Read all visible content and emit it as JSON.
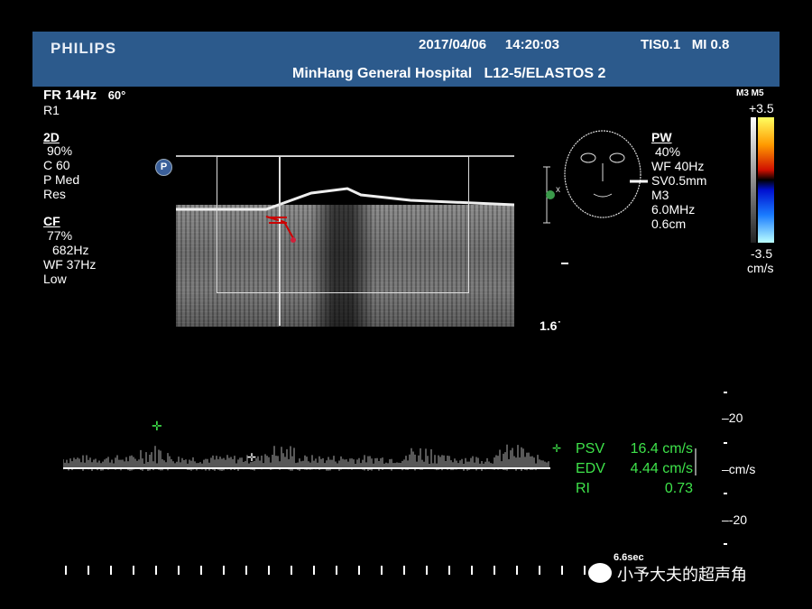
{
  "header": {
    "brand": "PHILIPS",
    "date": "2017/04/06",
    "time": "14:20:03",
    "tis": "TIS0.1",
    "mi": "MI 0.8",
    "hospital": "MinHang General Hospital",
    "probe": "L12-5/ELASTOS 2"
  },
  "left_params": {
    "frame_rate": "FR 14Hz",
    "angle": "60°",
    "r": "R1",
    "mode_2d": {
      "title": "2D",
      "gain": "90%",
      "compression": "C 60",
      "persistence": "P Med",
      "optimization": "Res"
    },
    "mode_cf": {
      "title": "CF",
      "gain": "77%",
      "prf": "682Hz",
      "wall_filter": "WF 37Hz",
      "setting": "Low"
    }
  },
  "pw_params": {
    "title": "PW",
    "gain": "40%",
    "wall_filter": "WF 40Hz",
    "sample_volume": "SV0.5mm",
    "preset": "M3",
    "frequency": "6.0MHz",
    "depth": "0.6cm"
  },
  "colorbar": {
    "label_top": "M3 M5",
    "max": "+3.5",
    "min": "-3.5",
    "unit": "cm/s"
  },
  "depth_label": "1.6",
  "spectrum": {
    "scale_top": "20",
    "scale_bottom": "-20",
    "unit": "cm/s",
    "sweep": "6.6sec"
  },
  "measurements": [
    {
      "label": "PSV",
      "value": "16.4 cm/s"
    },
    {
      "label": "EDV",
      "value": "4.44 cm/s"
    },
    {
      "label": "RI",
      "value": "0.73"
    }
  ],
  "watermark": "小予大夫的超声角",
  "colors": {
    "header_bg": "#2c5a8c",
    "measure_green": "#3ee24a",
    "roi_white": "#dddddd"
  }
}
